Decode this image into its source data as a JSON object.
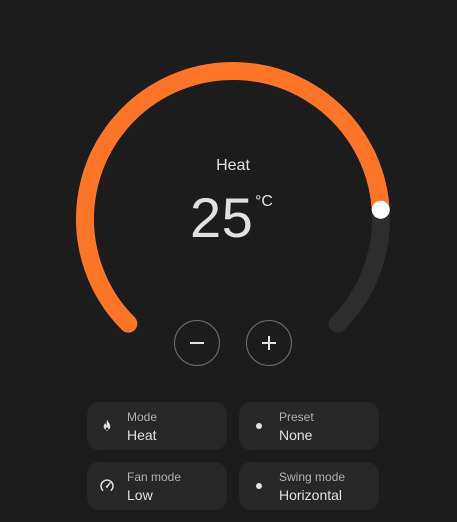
{
  "thermostat": {
    "mode": "Heat",
    "target_temperature": "25",
    "unit": "°C",
    "setpoint_fraction": 0.82,
    "active_color": "#ff7527",
    "track_color": "#2d2d2d",
    "handle_color": "#ffffff"
  },
  "controls": {
    "decrease_icon": "minus-icon",
    "increase_icon": "plus-icon"
  },
  "features": [
    {
      "name": "Mode",
      "value": "Heat",
      "icon": "flame-icon"
    },
    {
      "name": "Preset",
      "value": "None",
      "icon": "dot-icon"
    },
    {
      "name": "Fan mode",
      "value": "Low",
      "icon": "fan-speed-icon"
    },
    {
      "name": "Swing mode",
      "value": "Horizontal",
      "icon": "dot-icon"
    }
  ]
}
